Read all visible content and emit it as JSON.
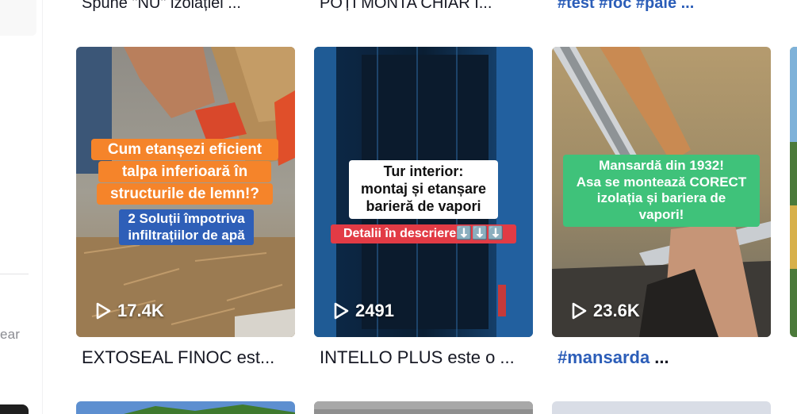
{
  "sidebar": {
    "partial_text": "ear"
  },
  "top_captions": [
    {
      "text": "Spune \"NU\" izolației ...",
      "style": "dark"
    },
    {
      "text": "POȚI MONTA CHIAR Î...",
      "style": "dark"
    },
    {
      "text": "#test #foc #pale ...",
      "style": "tag"
    }
  ],
  "videos": [
    {
      "views": "17.4K",
      "overlay": {
        "primary": [
          "Cum etanșezi eficient",
          "talpa inferioară în",
          "structurile de lemn!?"
        ],
        "secondary": [
          "2 Soluții împotriva",
          "infiltrațiilor de apă"
        ]
      },
      "caption": "EXTOSEAL FINOC est..."
    },
    {
      "views": "2491",
      "overlay": {
        "primary": [
          "Tur interior:",
          "montaj și etanșare",
          "barieră de vapori"
        ],
        "secondary": [
          "Detalii în descriere⬇️⬇️⬇️"
        ]
      },
      "caption": "INTELLO PLUS este o ..."
    },
    {
      "views": "23.6K",
      "overlay": {
        "primary": [
          "Mansardă din 1932!",
          "Asa se montează CORECT",
          "izolația și bariera de",
          "vapori!"
        ]
      },
      "caption_tag": "#mansarda",
      "caption_rest": " ..."
    }
  ],
  "colors": {
    "hashtag": "#2b5db8",
    "text": "#161823",
    "orange_label": "#f5842a",
    "blue_label": "#2e5fb8",
    "red_label": "#e23b45",
    "green_label": "#3fc27a"
  }
}
